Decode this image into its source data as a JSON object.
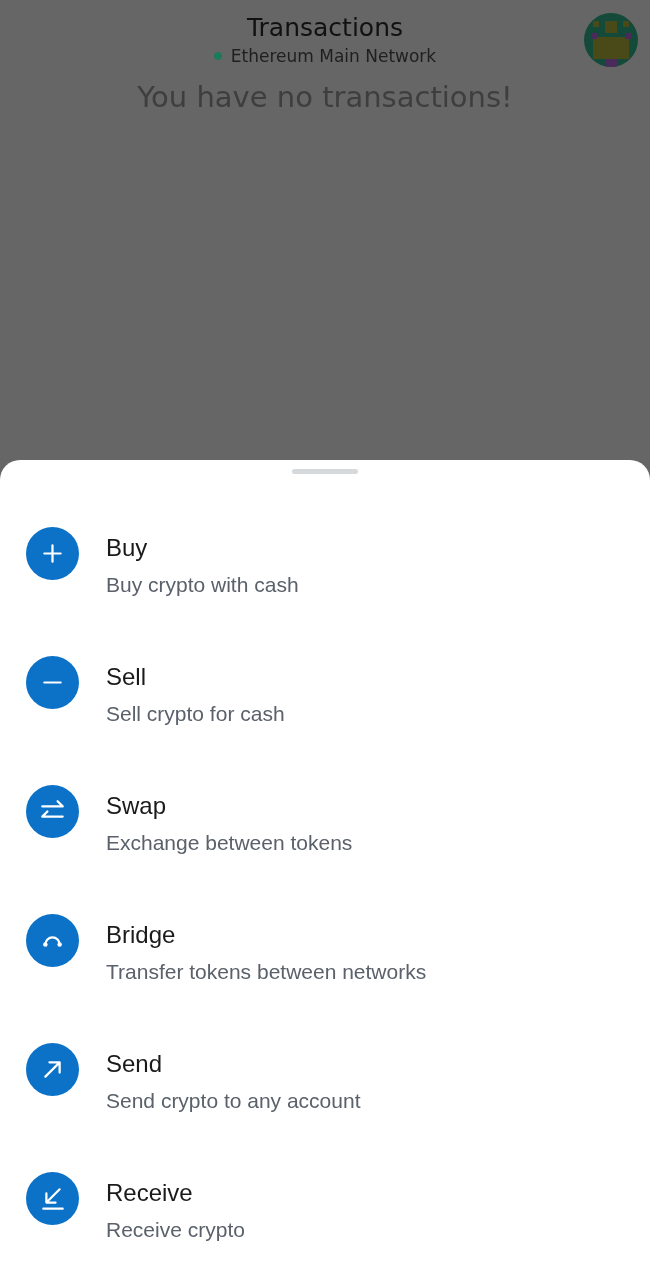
{
  "header": {
    "title": "Transactions",
    "network": "Ethereum Main Network"
  },
  "empty_message": "You have no transactions!",
  "actions": [
    {
      "kind": "buy",
      "title": "Buy",
      "subtitle": "Buy crypto with cash"
    },
    {
      "kind": "sell",
      "title": "Sell",
      "subtitle": "Sell crypto for cash"
    },
    {
      "kind": "swap",
      "title": "Swap",
      "subtitle": "Exchange between tokens"
    },
    {
      "kind": "bridge",
      "title": "Bridge",
      "subtitle": "Transfer tokens between networks"
    },
    {
      "kind": "send",
      "title": "Send",
      "subtitle": "Send crypto to any account"
    },
    {
      "kind": "receive",
      "title": "Receive",
      "subtitle": "Receive crypto"
    }
  ]
}
